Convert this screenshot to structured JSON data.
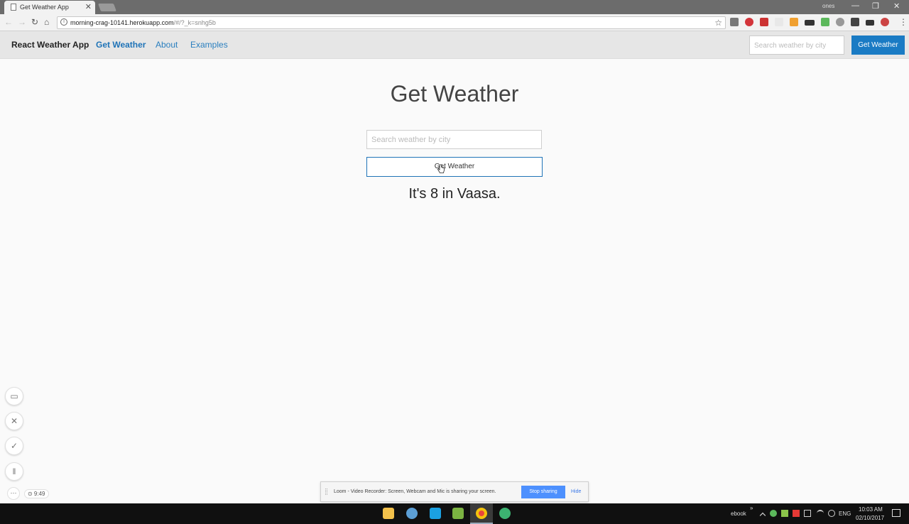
{
  "browser": {
    "tab_title": "Get Weather App",
    "tab_close": "✕",
    "window_user": "ones",
    "url_host": "morning-crag-10141.herokuapp.com",
    "url_path": "/#/?_k=snhg5b",
    "back_icon": "←",
    "forward_icon": "→",
    "reload_icon": "↻",
    "home_icon": "⌂",
    "star_icon": "☆",
    "menu_icon": "⋮",
    "win_min": "—",
    "win_restore": "❐",
    "win_close": "✕"
  },
  "navbar": {
    "brand": "React Weather App",
    "links": [
      "Get Weather",
      "About",
      "Examples"
    ],
    "search_placeholder": "Search weather by city",
    "button_label": "Get Weather"
  },
  "main": {
    "title": "Get Weather",
    "search_placeholder": "Search weather by city",
    "button_label": "Get Weather",
    "result_text": "It's 8 in Vaasa."
  },
  "loom": {
    "camera_icon": "▭",
    "cancel_icon": "✕",
    "done_icon": "✓",
    "pause_icon": "‖",
    "more_icon": "···",
    "timer": "⊙ 9:49"
  },
  "sharebar": {
    "message": "Loom - Video Recorder: Screen, Webcam and Mic is sharing your screen.",
    "stop_label": "Stop sharing",
    "hide_label": "Hide"
  },
  "taskbar": {
    "tray_label": "ebook",
    "tray_chevron": "»",
    "language": "ENG",
    "time": "10:03 AM",
    "date": "02/10/2017"
  },
  "colors": {
    "accent": "#1a7bc4",
    "link": "#2a7fbf",
    "navbar_bg": "#e6e6e6",
    "share_button": "#4d90fe"
  }
}
